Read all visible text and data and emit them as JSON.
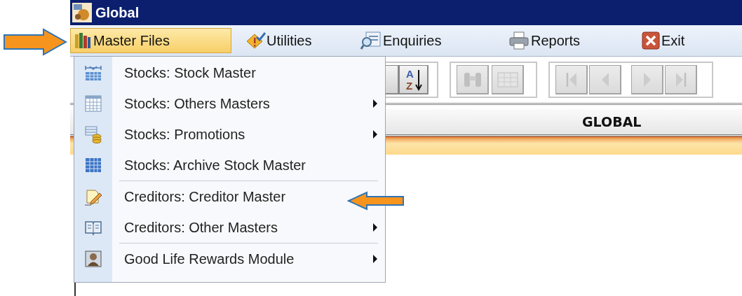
{
  "window": {
    "title": "Global"
  },
  "menu_bar": [
    {
      "label": "Master Files",
      "kind": "books",
      "selected": true
    },
    {
      "label": "Utilities",
      "kind": "utilities",
      "selected": false
    },
    {
      "label": "Enquiries",
      "kind": "enquiries",
      "selected": false
    },
    {
      "label": "Reports",
      "kind": "printer",
      "selected": false
    },
    {
      "label": "Exit",
      "kind": "exit",
      "selected": false
    }
  ],
  "toolbar": {
    "groups": [
      [
        {
          "kind": "partial",
          "disabled": false
        },
        {
          "kind": "sort",
          "disabled": false,
          "letters": [
            "A",
            "Z"
          ]
        }
      ],
      [
        {
          "kind": "find",
          "disabled": true
        },
        {
          "kind": "grid",
          "disabled": true
        }
      ],
      [
        {
          "kind": "first",
          "disabled": true
        },
        {
          "kind": "prev",
          "disabled": true
        },
        {
          "kind": "next",
          "disabled": true
        },
        {
          "kind": "last",
          "disabled": true
        }
      ]
    ]
  },
  "header": {
    "title": "GLOBAL"
  },
  "dropdown": {
    "items": [
      {
        "label": "Stocks: Stock Master",
        "kind": "stock",
        "submenu": false,
        "separator_before": false
      },
      {
        "label": "Stocks: Others Masters",
        "kind": "calendar",
        "submenu": true,
        "separator_before": false
      },
      {
        "label": "Stocks: Promotions",
        "kind": "coins",
        "submenu": true,
        "separator_before": false
      },
      {
        "label": "Stocks: Archive Stock Master",
        "kind": "table",
        "submenu": false,
        "separator_before": false
      },
      {
        "label": "Creditors: Creditor Master",
        "kind": "note",
        "submenu": false,
        "separator_before": true
      },
      {
        "label": "Creditors: Other Masters",
        "kind": "book",
        "submenu": true,
        "separator_before": false
      },
      {
        "label": "Good Life Rewards Module",
        "kind": "person",
        "submenu": true,
        "separator_before": true
      }
    ]
  }
}
